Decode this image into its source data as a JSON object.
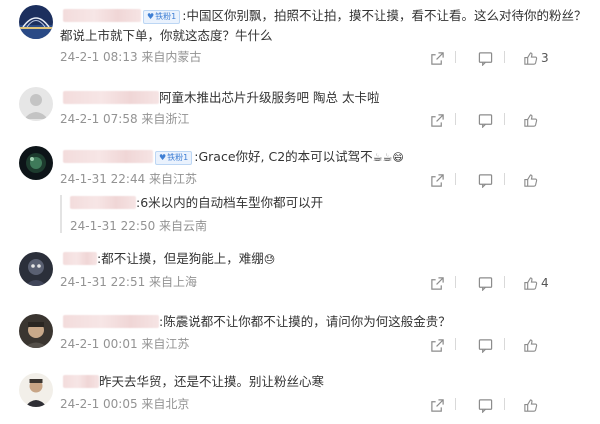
{
  "comments": [
    {
      "badge": "铁粉1",
      "text_line1": ":中国区你别飘，拍照不让拍，摸不让摸，看不让看。这么对待你的粉丝？",
      "text_line2": "都说上市就下单，你就这态度？牛什么",
      "meta": "24-2-1 08:13 来自内蒙古",
      "likes": "3"
    },
    {
      "text_line1": "阿童木推出芯片升级服务吧 陶总 太卡啦",
      "meta": "24-2-1 07:58 来自浙江"
    },
    {
      "badge": "铁粉1",
      "text_line1": ":Grace你好, C2的本可以试驾不",
      "emoji": "☕☕😄",
      "meta": "24-1-31 22:44 来自江苏"
    },
    {
      "reply": {
        "text": ":6米以内的自动档车型你都可以开",
        "meta": "24-1-31 22:50 来自云南"
      }
    },
    {
      "text_line1": ":都不让摸，但是狗能上，难绷",
      "emoji": "😓",
      "meta": "24-1-31 22:51 来自上海",
      "likes": "4"
    },
    {
      "text_line1": ":陈震说都不让你都不让摸的，请问你为何这般金贵？",
      "meta": "24-2-1 00:01 来自江苏"
    },
    {
      "text_line1": "昨天去华贸，还是不让摸。别让粉丝心寒",
      "meta": "24-2-1 00:05 来自北京"
    }
  ],
  "icons": {
    "share": "share-icon",
    "comment": "comment-icon",
    "like": "thumbs-up-icon"
  },
  "colors": {
    "meta": "#939393",
    "badge_bg": "#eaf2fd",
    "badge_text": "#3f7fd4"
  }
}
